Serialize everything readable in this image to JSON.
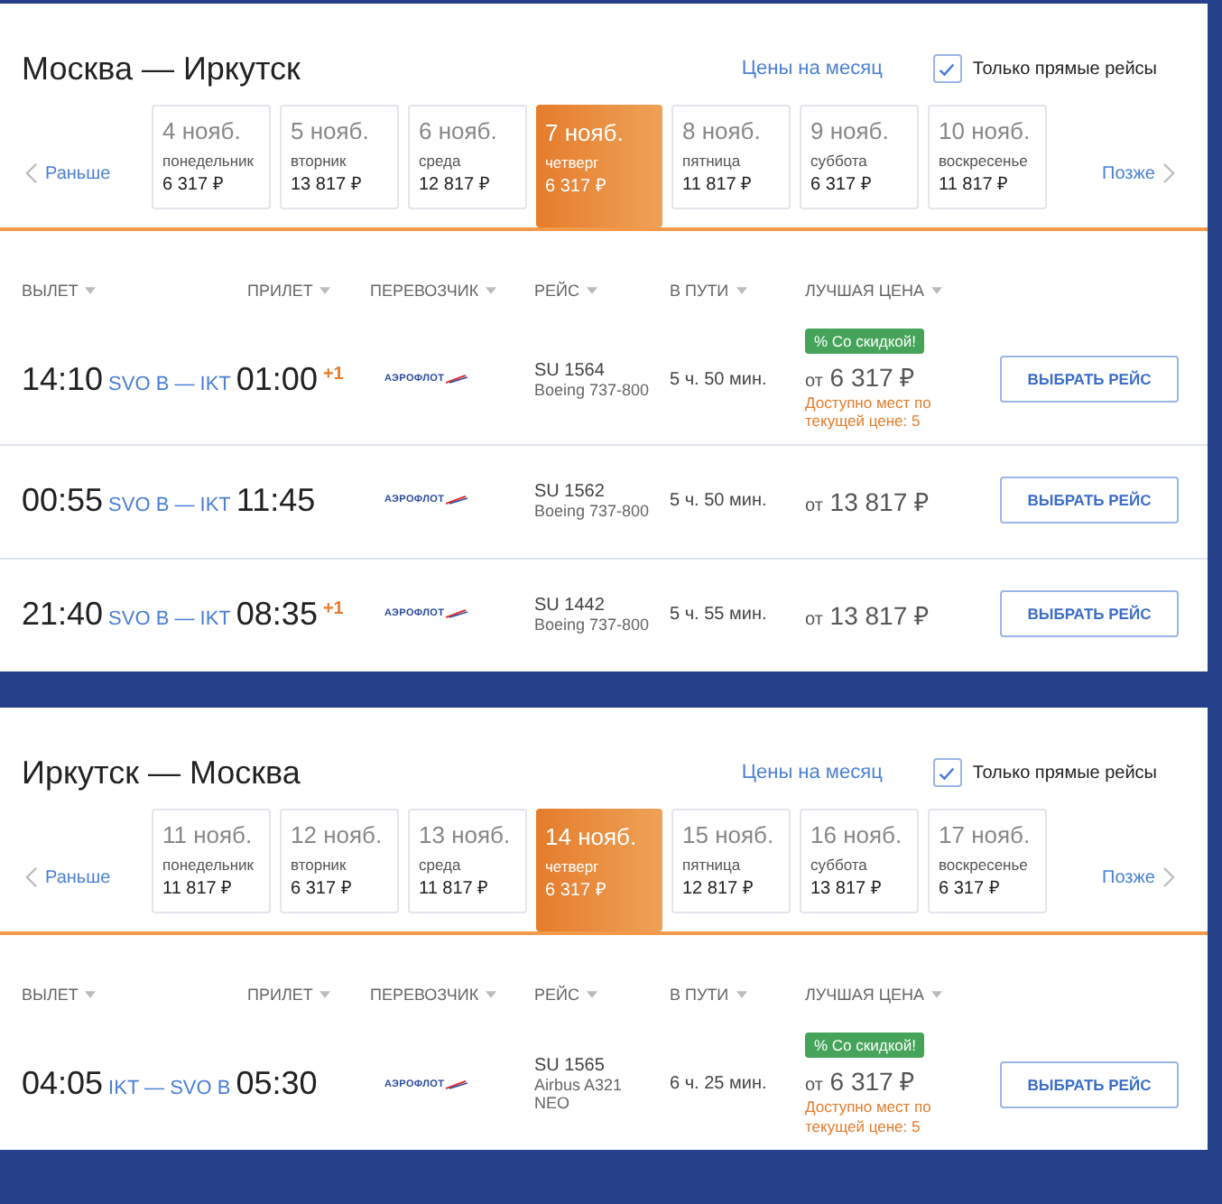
{
  "routes": [
    {
      "title": "Москва — Иркутск",
      "month_link": "Цены на месяц",
      "direct_only": {
        "label": "Только прямые рейсы",
        "checked": true
      },
      "earlier": "Раньше",
      "later": "Позже",
      "dates": [
        {
          "date": "4 нояб.",
          "weekday": "понедельник",
          "price": "6 317 ₽",
          "selected": false
        },
        {
          "date": "5 нояб.",
          "weekday": "вторник",
          "price": "13 817 ₽",
          "selected": false
        },
        {
          "date": "6 нояб.",
          "weekday": "среда",
          "price": "12 817 ₽",
          "selected": false
        },
        {
          "date": "7 нояб.",
          "weekday": "четверг",
          "price": "6 317 ₽",
          "selected": true
        },
        {
          "date": "8 нояб.",
          "weekday": "пятница",
          "price": "11 817 ₽",
          "selected": false
        },
        {
          "date": "9 нояб.",
          "weekday": "суббота",
          "price": "6 317 ₽",
          "selected": false
        },
        {
          "date": "10 нояб.",
          "weekday": "воскресенье",
          "price": "11 817 ₽",
          "selected": false
        }
      ],
      "columns": [
        "ВЫЛЕТ",
        "ПРИЛЕТ",
        "ПЕРЕВОЗЧИК",
        "РЕЙС",
        "В ПУТИ",
        "ЛУЧШАЯ ЦЕНА"
      ],
      "flights": [
        {
          "departure": "14:10",
          "airports": "SVO B — IKT",
          "arrival": "01:00",
          "next_day": "+1",
          "carrier": "АЭРОФЛОТ",
          "flight": "SU 1564",
          "aircraft": "Boeing 737-800",
          "duration": "5 ч. 50 мин.",
          "badge": "% Со скидкой!",
          "price_prefix": "от",
          "price": "6 317 ₽",
          "seats_note": "Доступно мест по текущей цене: 5",
          "button": "ВЫБРАТЬ РЕЙС"
        },
        {
          "departure": "00:55",
          "airports": "SVO B — IKT",
          "arrival": "11:45",
          "carrier": "АЭРОФЛОТ",
          "flight": "SU 1562",
          "aircraft": "Boeing 737-800",
          "duration": "5 ч. 50 мин.",
          "price_prefix": "от",
          "price": "13 817 ₽",
          "button": "ВЫБРАТЬ РЕЙС"
        },
        {
          "departure": "21:40",
          "airports": "SVO B — IKT",
          "arrival": "08:35",
          "next_day": "+1",
          "carrier": "АЭРОФЛОТ",
          "flight": "SU 1442",
          "aircraft": "Boeing 737-800",
          "duration": "5 ч. 55 мин.",
          "price_prefix": "от",
          "price": "13 817 ₽",
          "button": "ВЫБРАТЬ РЕЙС"
        }
      ]
    },
    {
      "title": "Иркутск — Москва",
      "month_link": "Цены на месяц",
      "direct_only": {
        "label": "Только прямые рейсы",
        "checked": true
      },
      "earlier": "Раньше",
      "later": "Позже",
      "dates": [
        {
          "date": "11 нояб.",
          "weekday": "понедельник",
          "price": "11 817 ₽",
          "selected": false
        },
        {
          "date": "12 нояб.",
          "weekday": "вторник",
          "price": "6 317 ₽",
          "selected": false
        },
        {
          "date": "13 нояб.",
          "weekday": "среда",
          "price": "11 817 ₽",
          "selected": false
        },
        {
          "date": "14 нояб.",
          "weekday": "четверг",
          "price": "6 317 ₽",
          "selected": true
        },
        {
          "date": "15 нояб.",
          "weekday": "пятница",
          "price": "12 817 ₽",
          "selected": false
        },
        {
          "date": "16 нояб.",
          "weekday": "суббота",
          "price": "13 817 ₽",
          "selected": false
        },
        {
          "date": "17 нояб.",
          "weekday": "воскресенье",
          "price": "6 317 ₽",
          "selected": false
        }
      ],
      "columns": [
        "ВЫЛЕТ",
        "ПРИЛЕТ",
        "ПЕРЕВОЗЧИК",
        "РЕЙС",
        "В ПУТИ",
        "ЛУЧШАЯ ЦЕНА"
      ],
      "flights": [
        {
          "departure": "04:05",
          "airports": "IKT — SVO B",
          "arrival": "05:30",
          "carrier": "АЭРОФЛОТ",
          "flight": "SU 1565",
          "aircraft": "Airbus A321 NEO",
          "duration": "6 ч. 25 мин.",
          "badge": "% Со скидкой!",
          "price_prefix": "от",
          "price": "6 317 ₽",
          "seats_note": "Доступно мест по текущей цене: 5",
          "button": "ВЫБРАТЬ РЕЙС"
        }
      ]
    }
  ]
}
